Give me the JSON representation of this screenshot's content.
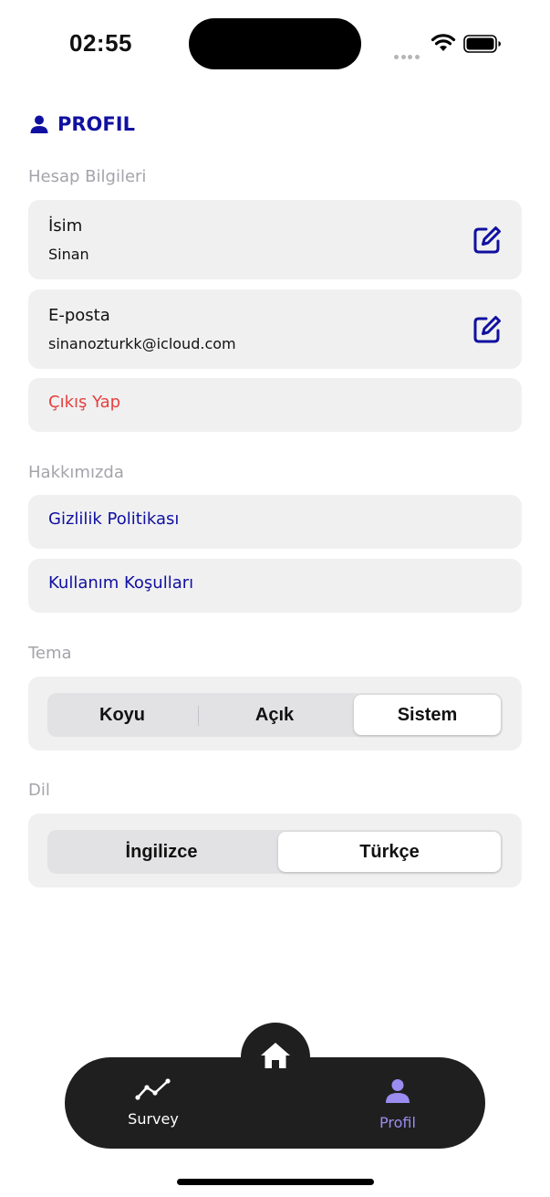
{
  "status_bar": {
    "time": "02:55"
  },
  "header": {
    "title": "PROFIL",
    "icon": "person-icon"
  },
  "account": {
    "section_label": "Hesap Bilgileri",
    "name_label": "İsim",
    "name_value": "Sinan",
    "email_label": "E-posta",
    "email_value": "sinanozturkk@icloud.com",
    "logout_label": "Çıkış Yap"
  },
  "about": {
    "section_label": "Hakkımızda",
    "privacy_label": "Gizlilik Politikası",
    "terms_label": "Kullanım Koşulları"
  },
  "theme": {
    "section_label": "Tema",
    "options": [
      "Koyu",
      "Açık",
      "Sistem"
    ],
    "selected": "Sistem"
  },
  "language": {
    "section_label": "Dil",
    "options": [
      "İngilizce",
      "Türkçe"
    ],
    "selected": "Türkçe"
  },
  "tabbar": {
    "tabs": [
      {
        "label": "Survey",
        "icon": "chart-line-icon"
      },
      {
        "label": "Profil",
        "icon": "person-icon"
      }
    ],
    "center_icon": "home-icon",
    "active": "Profil"
  },
  "colors": {
    "accent": "#1010a0",
    "danger": "#e64040",
    "active_tab": "#9a8cf0",
    "card": "#f0f0f0",
    "tabbar": "#1f1f1f"
  }
}
